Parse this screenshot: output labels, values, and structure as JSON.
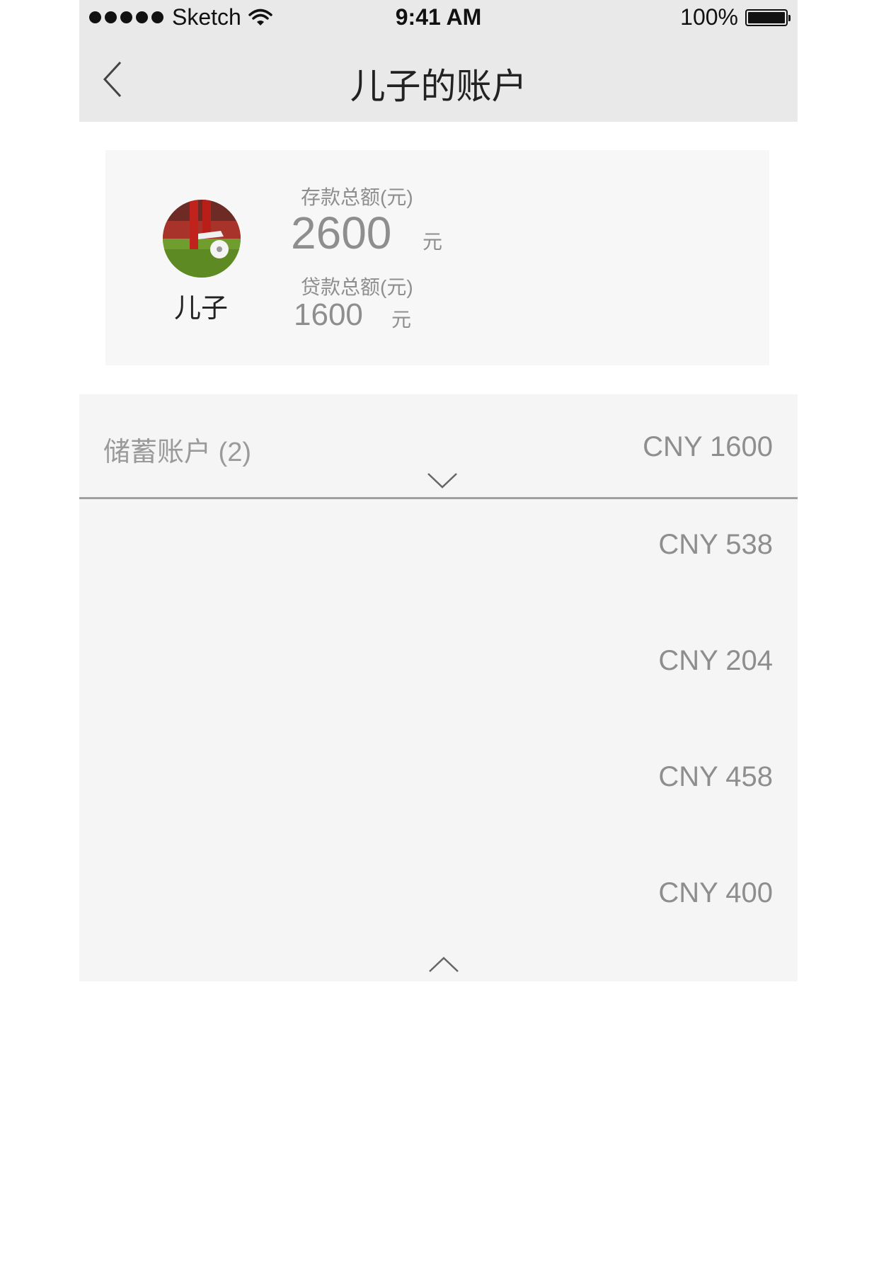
{
  "status_bar": {
    "carrier": "Sketch",
    "time": "9:41 AM",
    "battery": "100%"
  },
  "nav": {
    "title": "儿子的账户",
    "back_icon": "chevron-left-icon"
  },
  "profile": {
    "name": "儿子",
    "deposit_label": "存款总额(元)",
    "deposit_value": "2600",
    "deposit_unit": "元",
    "loan_label": "贷款总额(元)",
    "loan_value": "1600",
    "loan_unit": "元"
  },
  "savings": {
    "title": "储蓄账户 (2)",
    "total": "CNY 1600",
    "expand_icon": "chevron-down-icon",
    "collapse_icon": "chevron-up-icon",
    "accounts": [
      {
        "amount": "CNY 538"
      },
      {
        "amount": "CNY 204"
      },
      {
        "amount": "CNY 458"
      },
      {
        "amount": "CNY 400"
      }
    ]
  },
  "colors": {
    "nav_background": "#e9e9e9",
    "card_background": "#f7f7f7",
    "panel_background": "#f5f5f5",
    "muted_text": "#8e8e8e",
    "divider": "#a0a0a0"
  }
}
